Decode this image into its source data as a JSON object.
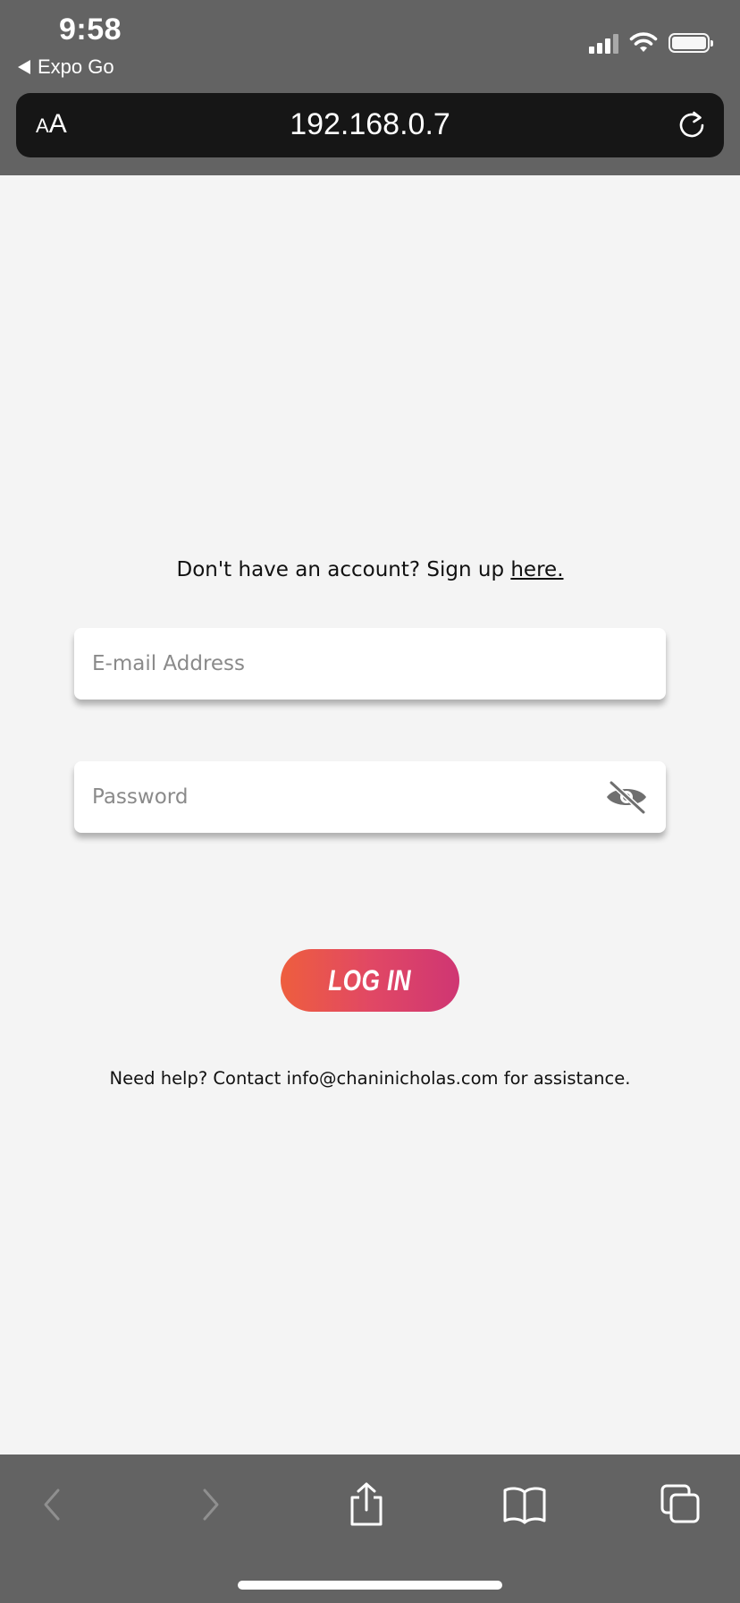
{
  "status_bar": {
    "time": "9:58",
    "back_app_label": "Expo Go"
  },
  "browser": {
    "text_size_small": "A",
    "text_size_large": "A",
    "url": "192.168.0.7"
  },
  "login": {
    "signup_prompt": "Don't have an account? Sign up ",
    "signup_link": "here.",
    "email_placeholder": "E-mail Address",
    "password_placeholder": "Password",
    "login_button": "LOG IN",
    "help_text": "Need help? Contact info@chaninicholas.com for assistance.",
    "button_gradient": [
      "#ee5e3e",
      "#cf3673"
    ]
  },
  "toolbar": {
    "icons": [
      "back-icon",
      "forward-icon",
      "share-icon",
      "bookmarks-icon",
      "tabs-icon"
    ]
  },
  "colors": {
    "chrome": "#636363",
    "url_bar": "#161616",
    "page_background": "#f4f4f4"
  }
}
